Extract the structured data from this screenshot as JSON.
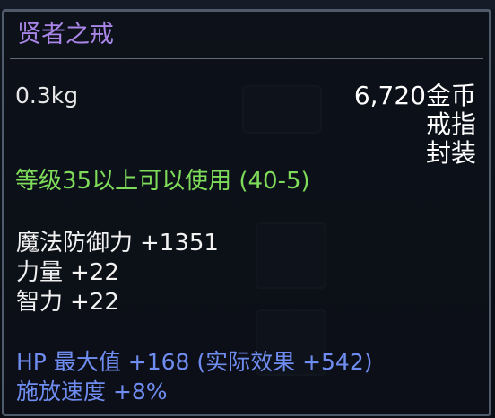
{
  "item": {
    "name": "贤者之戒",
    "weight": "0.3kg",
    "price": "6,720金币",
    "type": "戒指",
    "bind_status": "封装",
    "level_requirement": "等级35以上可以使用 (40-5)"
  },
  "stats": [
    {
      "label": "魔法防御力",
      "value": "+1351"
    },
    {
      "label": "力量",
      "value": "+22"
    },
    {
      "label": "智力",
      "value": "+22"
    }
  ],
  "effects": [
    "HP 最大值 +168 (实际效果 +542)",
    "施放速度 +8%"
  ],
  "colors": {
    "name": "#a986e8",
    "requirement": "#7fdc5a",
    "effect": "#6f8cf0"
  }
}
